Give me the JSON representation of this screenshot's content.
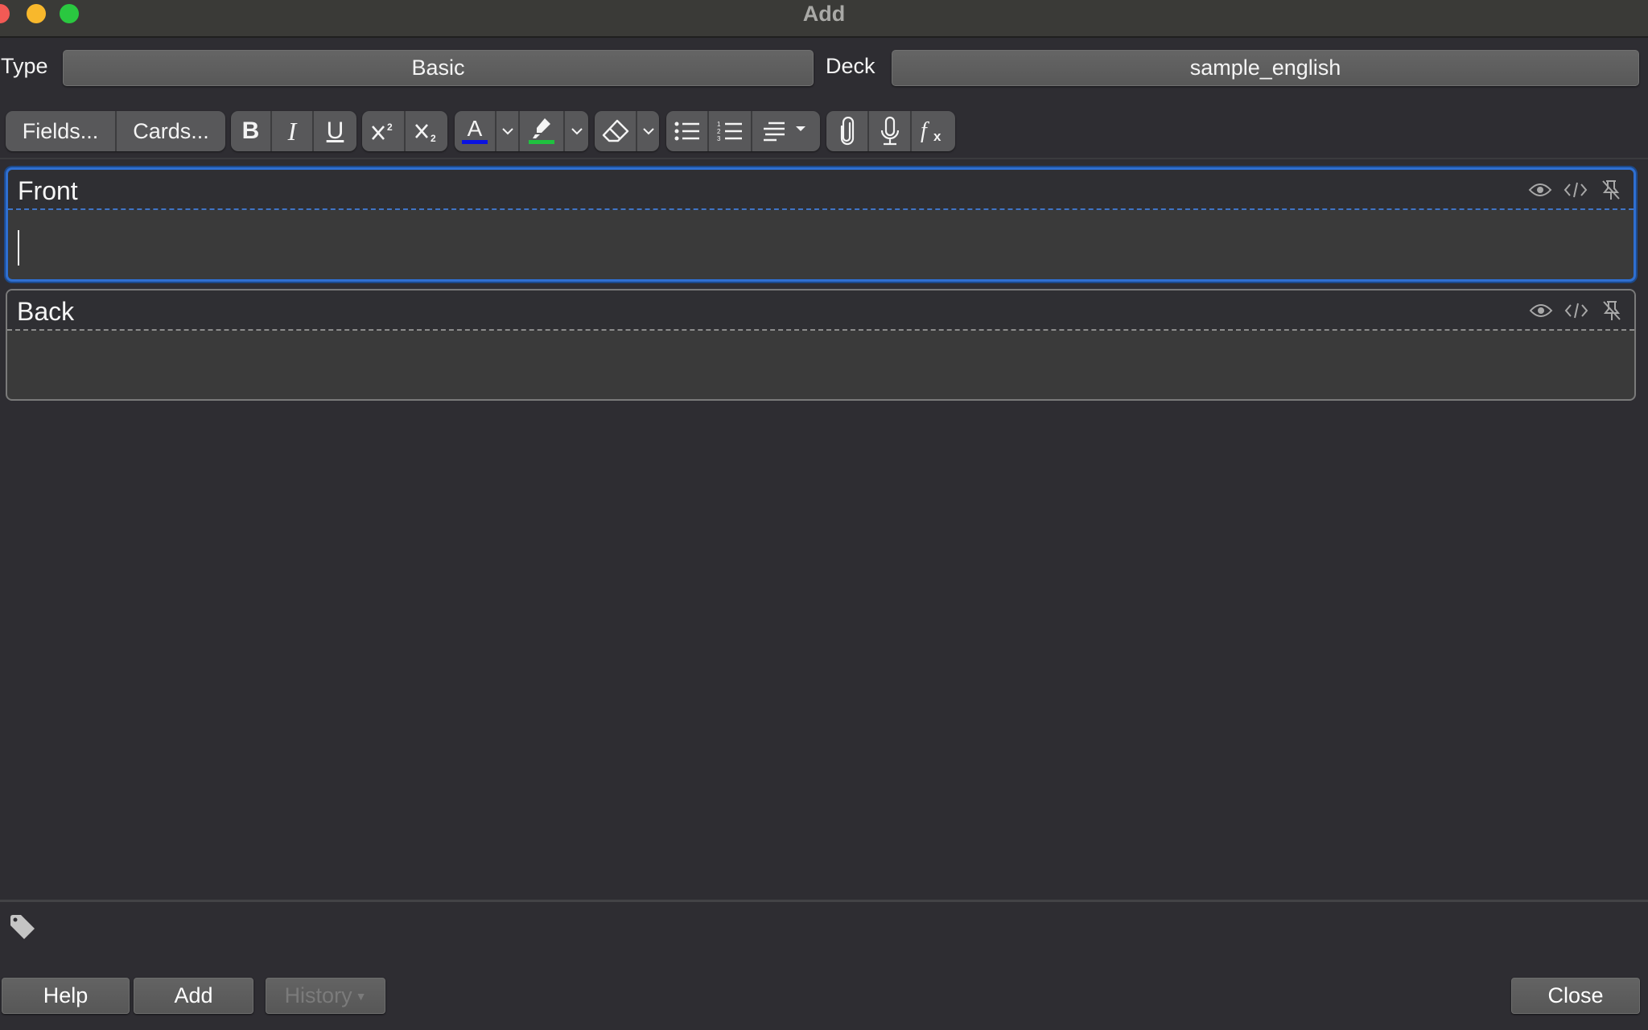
{
  "window": {
    "title": "Add"
  },
  "header": {
    "type_label": "Type",
    "type_value": "Basic",
    "deck_label": "Deck",
    "deck_value": "sample_english"
  },
  "toolbar": {
    "fields_label": "Fields...",
    "cards_label": "Cards...",
    "bold_label": "B",
    "italic_label": "I",
    "underline_label": "U",
    "text_color": "#0a12e0",
    "highlight_color": "#1fc23f",
    "icons": [
      "superscript-icon",
      "subscript-icon",
      "text-color-icon",
      "highlighter-icon",
      "eraser-icon",
      "bullet-list-icon",
      "numbered-list-icon",
      "align-icon",
      "paperclip-icon",
      "microphone-icon",
      "math-fx-icon"
    ]
  },
  "fields": [
    {
      "name": "Front",
      "value": "",
      "focused": true
    },
    {
      "name": "Back",
      "value": "",
      "focused": false
    }
  ],
  "footer": {
    "help_label": "Help",
    "add_label": "Add",
    "history_label": "History",
    "close_label": "Close"
  },
  "colors": {
    "focus_accent": "#2f6fd1"
  }
}
